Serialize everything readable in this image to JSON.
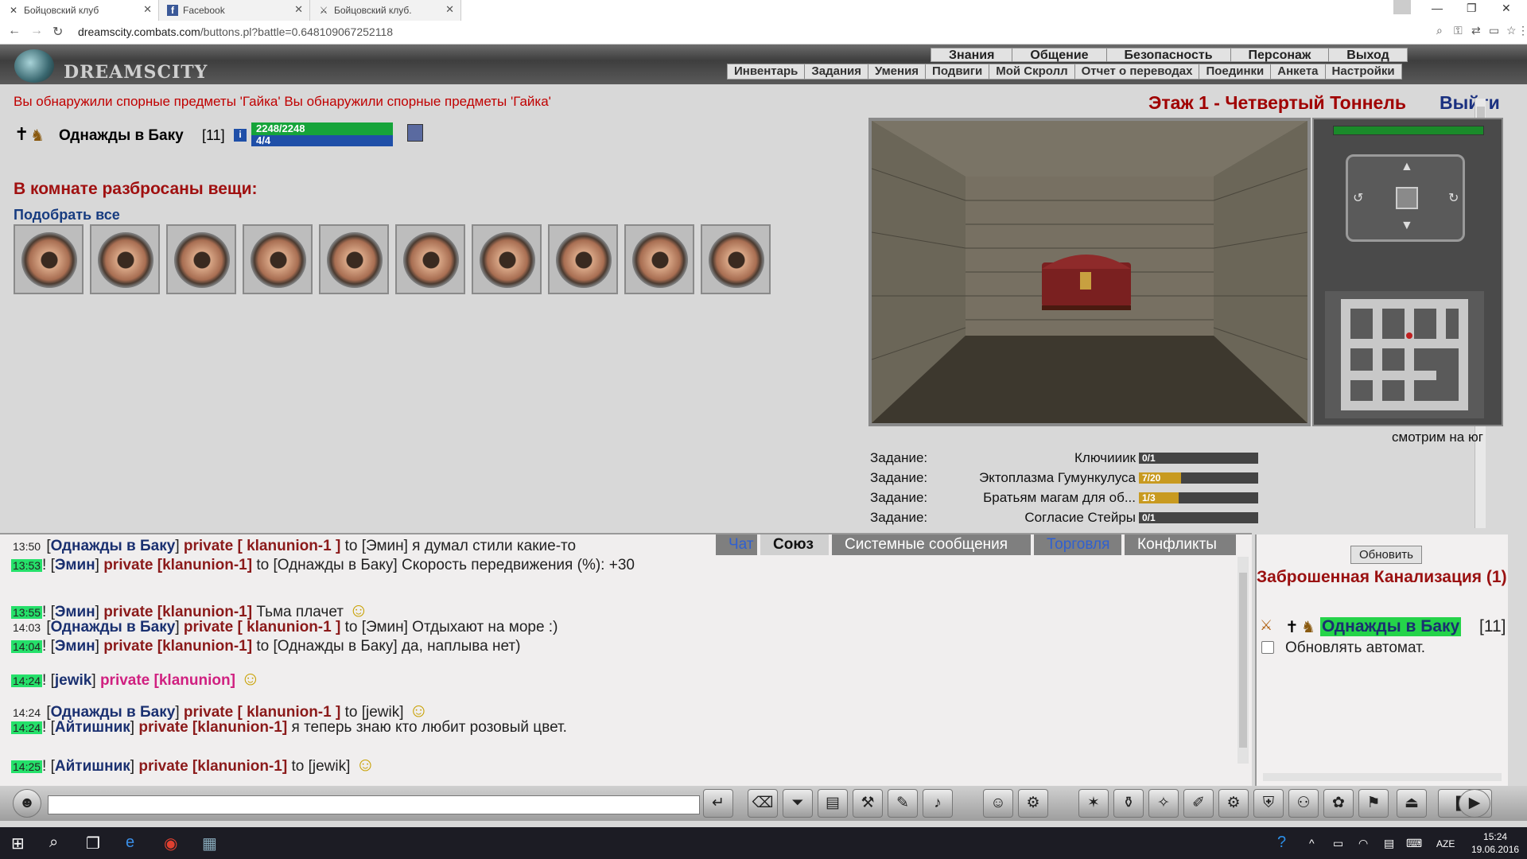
{
  "browser": {
    "tabs": [
      {
        "icon": "crossed-swords-icon",
        "title": "Бойцовский клуб"
      },
      {
        "icon": "facebook-icon",
        "title": "Facebook"
      },
      {
        "icon": "swords-icon",
        "title": "Бойцовский клуб."
      }
    ],
    "url_host": "dreamscity.combats.com",
    "url_path": "/buttons.pl?battle=0.648109067252118"
  },
  "site": {
    "logo": "DREAMSCITY",
    "top_menu": [
      "Знания",
      "Общение",
      "Безопасность",
      "Персонаж",
      "Выход"
    ],
    "sub_menu": [
      "Инвентарь",
      "Задания",
      "Умения",
      "Подвиги",
      "Мой Скролл",
      "Отчет о переводах",
      "Поединки",
      "Анкета",
      "Настройки"
    ]
  },
  "room": {
    "alert": "Вы обнаружили спорные предметы 'Гайка' Вы обнаружили спорные предметы 'Гайка'",
    "floor_title": "Этаж 1 - Четвертый Тоннель",
    "exit_label": "Выйти",
    "items_title": "В комнате разбросаны вещи:",
    "pick_all": "Подобрать все",
    "item_count": 10,
    "item_name": "Гайка",
    "facing": "смотрим на юг"
  },
  "player": {
    "name": "Однажды в Баку",
    "level": "[11]",
    "hp": "2248/2248",
    "mana": "4/4",
    "hp_fraction": 1.0,
    "mana_fraction": 1.0
  },
  "quests": [
    {
      "label": "Задание:",
      "name": "Ключииик",
      "progress": "0/1",
      "fraction": 0.0
    },
    {
      "label": "Задание:",
      "name": "Эктоплазма Гумункулуса",
      "progress": "7/20",
      "fraction": 0.35
    },
    {
      "label": "Задание:",
      "name": "Братьям магам для об...",
      "progress": "1/3",
      "fraction": 0.33
    },
    {
      "label": "Задание:",
      "name": "Согласие Стейры",
      "progress": "0/1",
      "fraction": 0.0
    }
  ],
  "chat": {
    "tabs": [
      "Чат",
      "Союз",
      "Системные сообщения",
      "Торговля",
      "Конфликты"
    ],
    "active_tab": "Союз",
    "messages": [
      {
        "time": "13:50",
        "from": "Однажды в Баку",
        "channel": "private [ klanunion-1 ]",
        "to": "to [Эмин]",
        "text": "я думал стили какие-то"
      },
      {
        "time": "13:53",
        "from": "Эмин",
        "channel": "private [klanunion-1]",
        "to": "to [Однажды в Баку]",
        "text": "Скорость передвижения (%): +30"
      },
      {
        "time": "13:55",
        "from": "Эмин",
        "channel": "private [klanunion-1]",
        "to": "",
        "text": "Тьма плачет"
      },
      {
        "time": "14:03",
        "from": "Однажды в Баку",
        "channel": "private [ klanunion-1 ]",
        "to": "to [Эмин]",
        "text": "Отдыхают на море :)"
      },
      {
        "time": "14:04",
        "from": "Эмин",
        "channel": "private [klanunion-1]",
        "to": "to [Однажды в Баку]",
        "text": "да, наплыва нет)"
      },
      {
        "time": "14:24",
        "from": "jewik",
        "channel": "private [klanunion]",
        "to": "",
        "text": ""
      },
      {
        "time": "14:24",
        "from": "Однажды в Баку",
        "channel": "private [ klanunion-1 ]",
        "to": "to [jewik]",
        "text": ""
      },
      {
        "time": "14:24",
        "from": "Айтишник",
        "channel": "private [klanunion-1]",
        "to": "",
        "text": "я теперь знаю кто любит розовый цвет."
      },
      {
        "time": "14:25",
        "from": "Айтишник",
        "channel": "private [klanunion-1]",
        "to": "to [jewik]",
        "text": ""
      }
    ]
  },
  "online": {
    "refresh": "Обновить",
    "location": "Заброшенная Канализация (1)",
    "member": "Однажды в Баку",
    "member_level": "[11]",
    "auto_refresh": "Обновлять автомат."
  },
  "taskbar": {
    "lang": "AZE",
    "time": "15:24",
    "date": "19.06.2016"
  },
  "colors": {
    "alert": "#c00000",
    "hp": "#16a43a",
    "mana": "#1f4fa8",
    "timestamp_highlight": "#25e06a"
  }
}
